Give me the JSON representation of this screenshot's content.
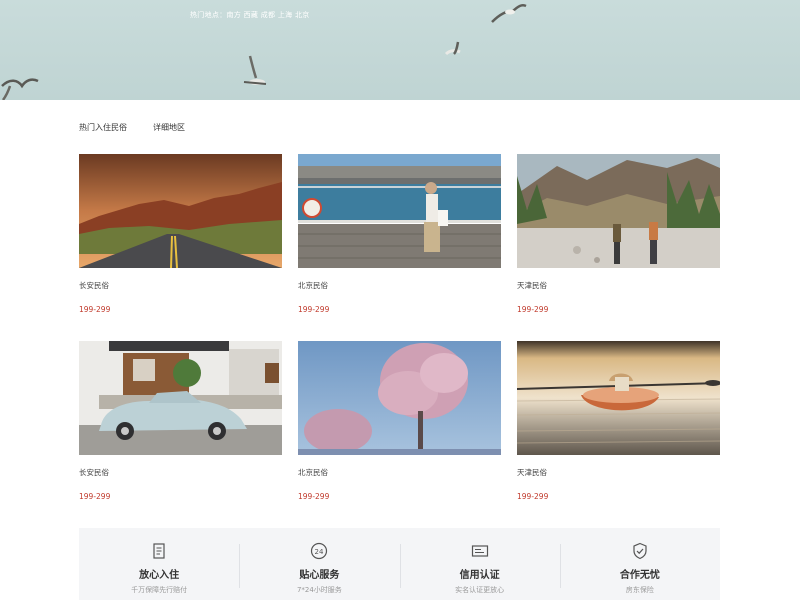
{
  "hero": {
    "hot_cities": "热门地点：南方 西藏 成都 上海 北京",
    "background_color": "#c5d9d8"
  },
  "tabs": [
    {
      "label": "热门入住民俗"
    },
    {
      "label": "详细地区"
    }
  ],
  "cards": [
    {
      "name": "长安民俗",
      "price": "199-299",
      "image": "desert-road"
    },
    {
      "name": "北京民俗",
      "price": "199-299",
      "image": "boardwalk-walker"
    },
    {
      "name": "天津民俗",
      "price": "199-299",
      "image": "mountain-hikers"
    },
    {
      "name": "长安民俗",
      "price": "199-299",
      "image": "vintage-car"
    },
    {
      "name": "北京民俗",
      "price": "199-299",
      "image": "pink-tree"
    },
    {
      "name": "天津民俗",
      "price": "199-299",
      "image": "kayak-lake"
    }
  ],
  "features": [
    {
      "title": "放心入住",
      "subtitle": "千万保障先行赔付",
      "icon": "document-icon"
    },
    {
      "title": "贴心服务",
      "subtitle": "7*24小时服务",
      "icon": "clock-24-icon"
    },
    {
      "title": "信用认证",
      "subtitle": "实名认证更放心",
      "icon": "id-card-icon"
    },
    {
      "title": "合作无忧",
      "subtitle": "房东保险",
      "icon": "shield-check-icon"
    }
  ],
  "colors": {
    "price": "#c0392b",
    "features_bg": "#f4f5f7"
  }
}
